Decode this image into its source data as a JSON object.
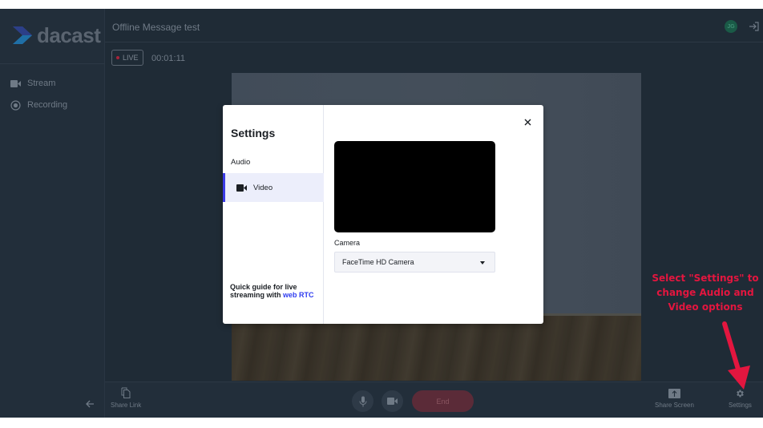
{
  "brand": {
    "name": "dacast",
    "icon": "dacast-chevron-logo"
  },
  "sidebar": {
    "items": [
      {
        "label": "Stream",
        "icon": "video-camera-icon"
      },
      {
        "label": "Recording",
        "icon": "record-icon"
      }
    ],
    "collapse_icon": "arrow-left-icon"
  },
  "header": {
    "title": "Offline Message test",
    "avatar_initials": "JG",
    "logout_icon": "logout-icon"
  },
  "live": {
    "badge": "LIVE",
    "timer": "00:01:11"
  },
  "bottom_bar": {
    "share_link": "Share Link",
    "end": "End",
    "share_screen": "Share Screen",
    "settings": "Settings"
  },
  "modal": {
    "title": "Settings",
    "tabs": [
      {
        "label": "Audio",
        "active": false
      },
      {
        "label": "Video",
        "active": true,
        "icon": "video-camera-icon"
      }
    ],
    "guide_text": "Quick guide for live streaming with ",
    "guide_link": "web RTC",
    "camera_label": "Camera",
    "camera_value": "FaceTime HD Camera",
    "close_icon": "close-icon"
  },
  "annotation": {
    "text": "Select \"Settings\" to change Audio and Video options",
    "color": "#e3163f"
  },
  "colors": {
    "app_bg": "#1f2b36",
    "accent": "#3b3be6",
    "link": "#2f3cf0",
    "live_dot": "#a8243a",
    "end_button": "#5b2b38"
  }
}
